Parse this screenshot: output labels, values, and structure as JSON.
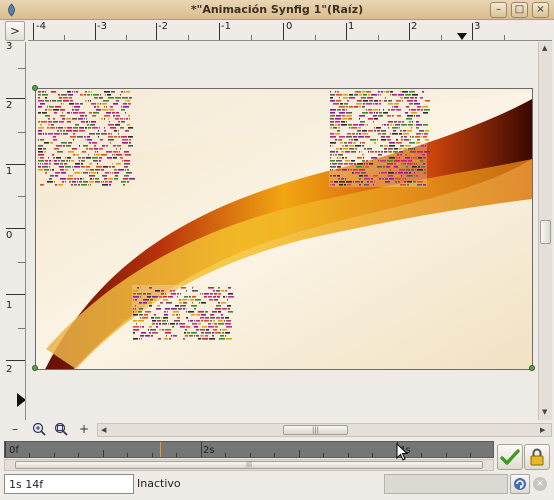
{
  "window": {
    "title": "*\"Animación Synfig 1\"(Raíz)",
    "controls": [
      "minimize-icon",
      "maximize-icon",
      "close-icon"
    ]
  },
  "ruler": {
    "toggle_label": ">",
    "h_labels": [
      "-4",
      "-3",
      "-2",
      "-1",
      "0",
      "1",
      "2",
      "3"
    ],
    "v_labels": [
      "3",
      "2",
      "1",
      "0",
      "1",
      "2"
    ]
  },
  "canvas": {
    "description_colors": {
      "accent_orange": "#e58a12",
      "dark_red": "#7a1608",
      "cream": "#f6ecd8"
    },
    "handle_color": "#5fa04b"
  },
  "zoom_tools": [
    "zoom-out-icon",
    "zoom-in-icon",
    "zoom-fit-icon",
    "add-icon"
  ],
  "timebar": {
    "labels": [
      "0f",
      "2s",
      "4s"
    ],
    "current_time_field": "1s 14f"
  },
  "status": {
    "text": "Inactivo"
  }
}
